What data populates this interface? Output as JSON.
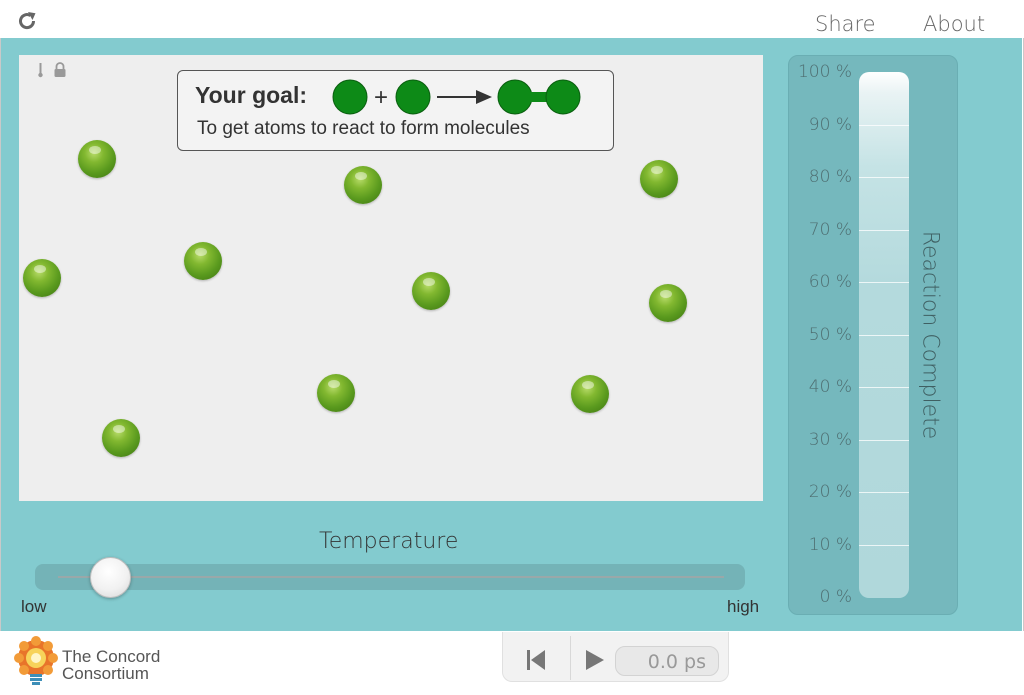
{
  "header": {
    "share_label": "Share",
    "about_label": "About"
  },
  "goal": {
    "title": "Your goal:",
    "plus": "+",
    "description": "To get atoms to react to form molecules"
  },
  "temperature": {
    "label": "Temperature",
    "low_label": "low",
    "high_label": "high",
    "value_fraction": 0.08
  },
  "gauge": {
    "title": "Reaction Complete",
    "ticks": [
      "100 %",
      "90 %",
      "80 %",
      "70 %",
      "60 %",
      "50 %",
      "40 %",
      "30 %",
      "20 %",
      "10 %",
      "0 %"
    ],
    "value_percent": 0
  },
  "footer": {
    "logo_line1": "The Concord",
    "logo_line2": "Consortium",
    "time": "0.0 ps"
  },
  "colors": {
    "panel": "#83cbcf",
    "atom": "#5a9a1e",
    "goal_atom": "#0d8a17"
  },
  "icons": {
    "reload": "reload-icon",
    "reset": "reset-icon",
    "play": "play-icon",
    "lock": "lock-icon",
    "thermometer": "thermometer-icon"
  }
}
